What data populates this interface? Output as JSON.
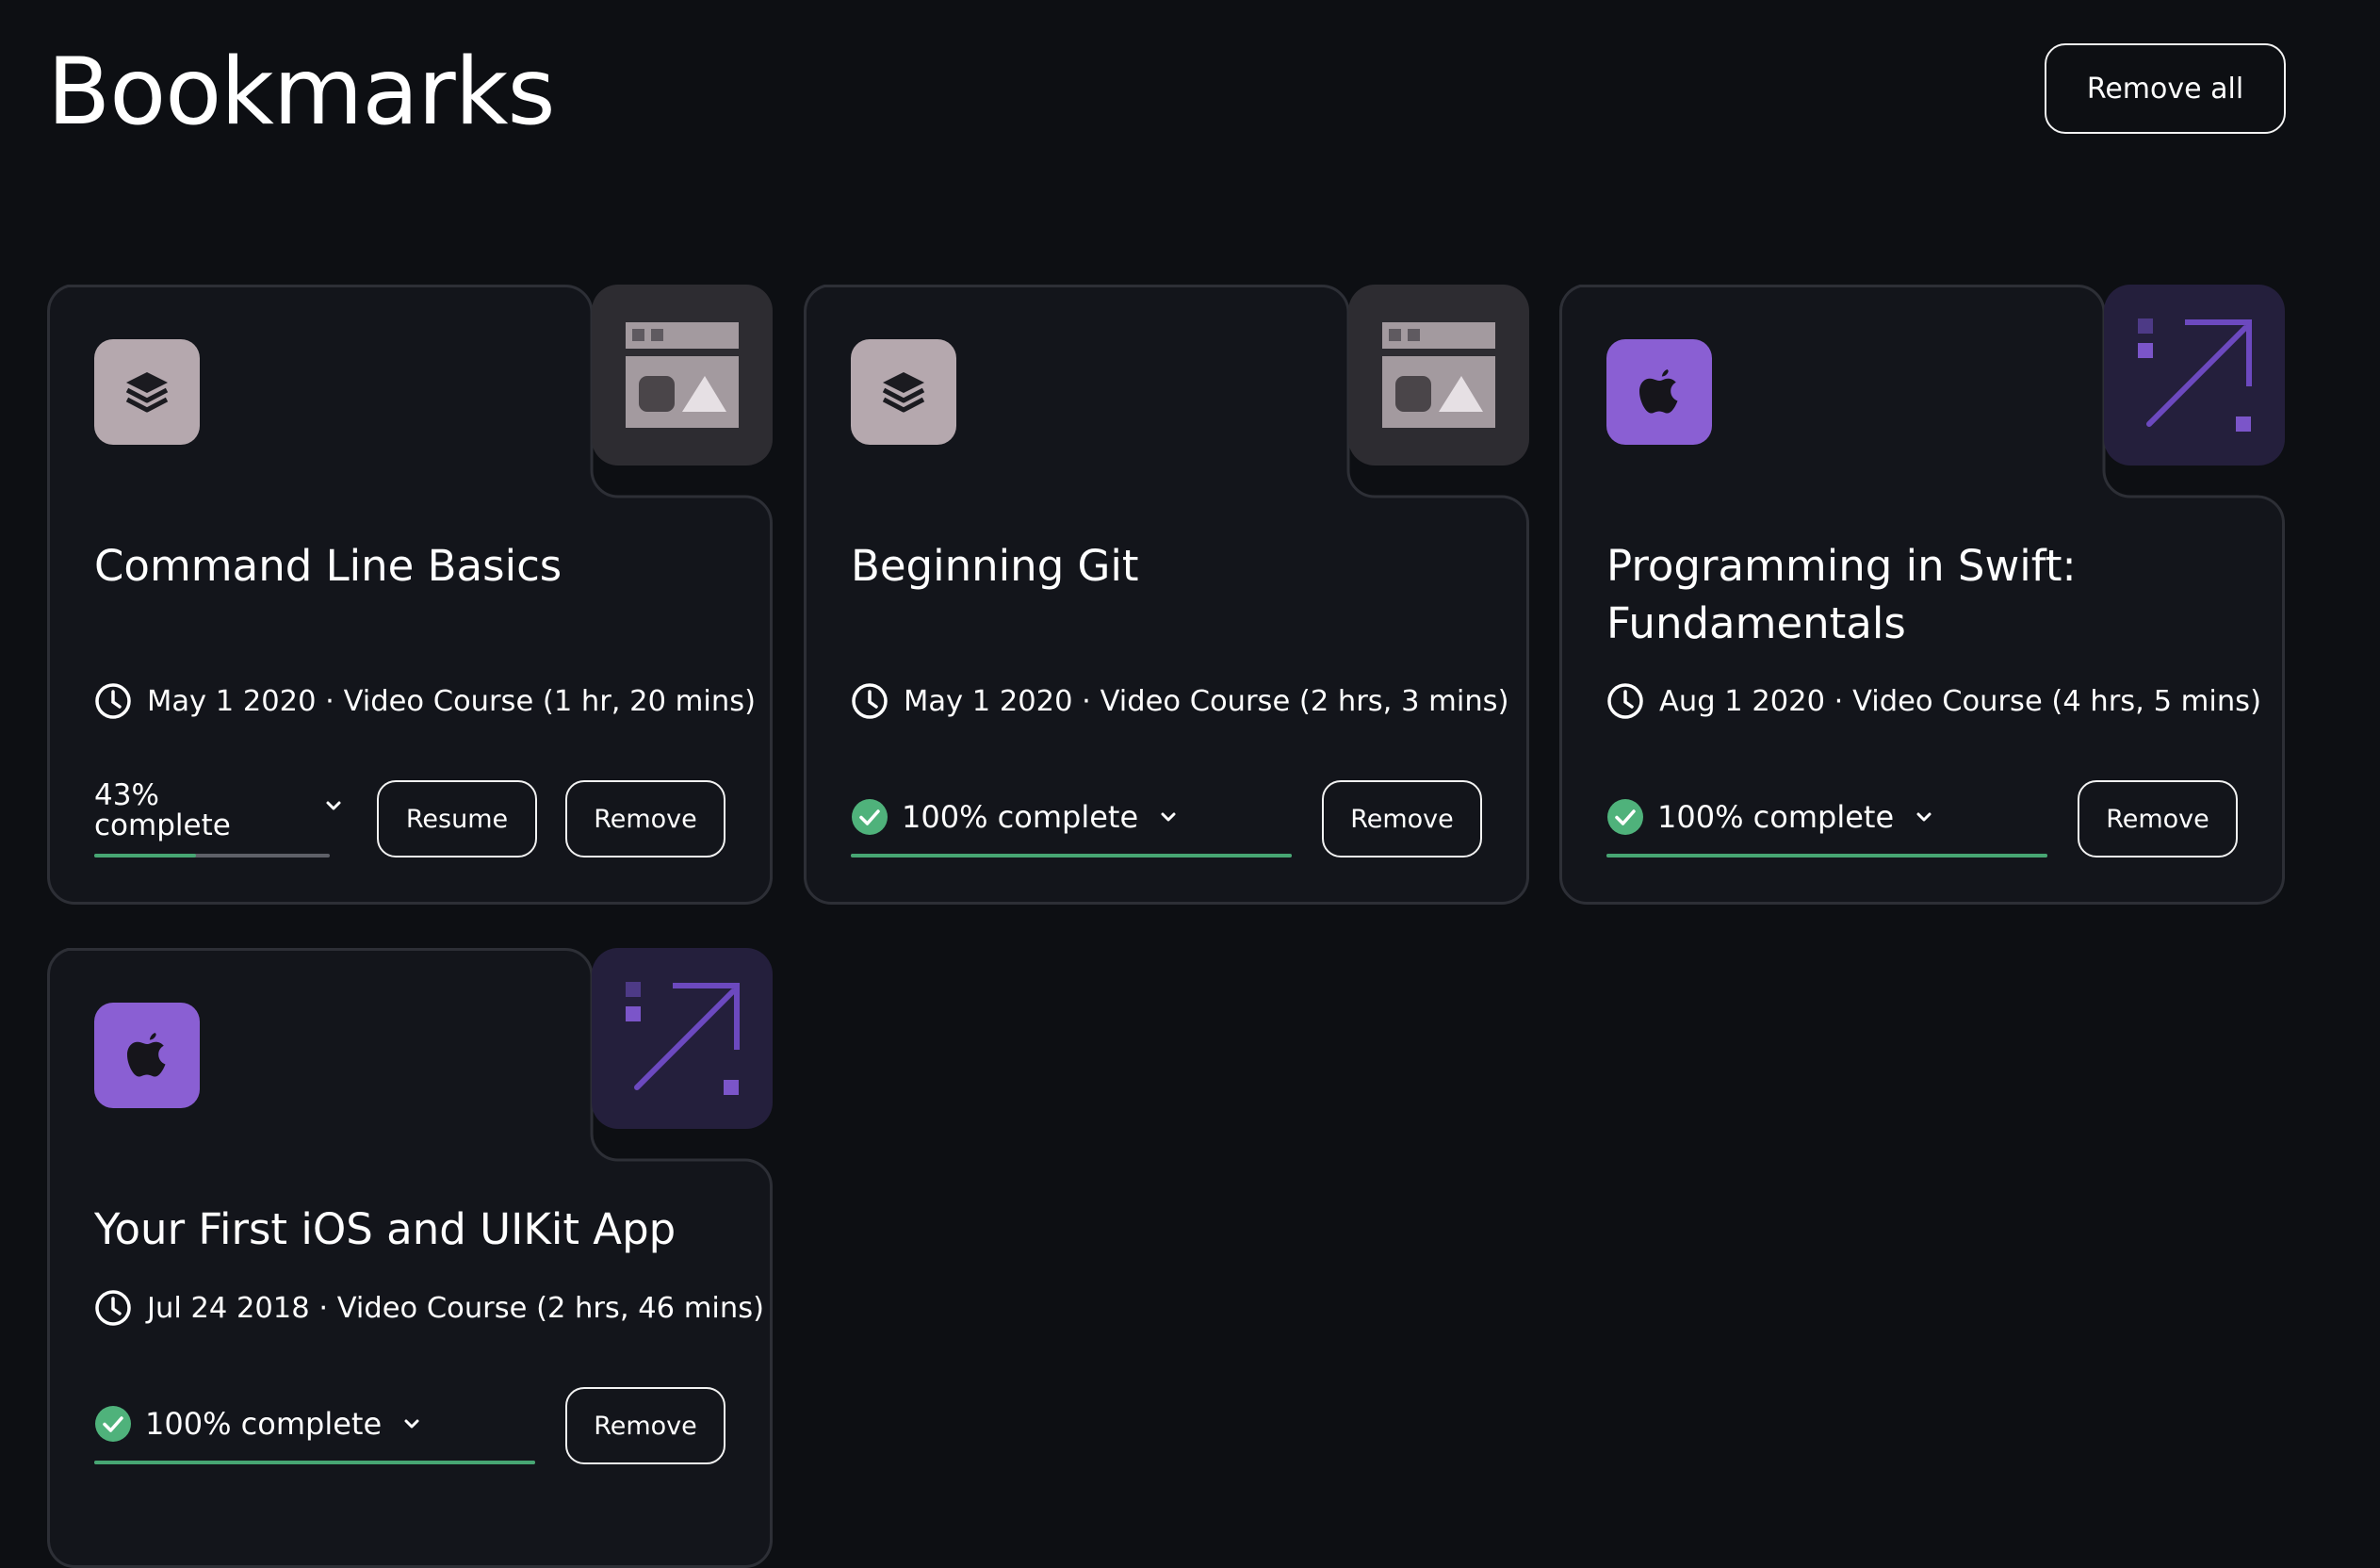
{
  "page": {
    "title": "Bookmarks",
    "remove_all_label": "Remove all"
  },
  "colors": {
    "background": "#0d0f13",
    "card_background": "#13151b",
    "card_border": "#2d2f36",
    "progress_green": "#47a673",
    "check_green": "#4fb27b",
    "purple_accent": "#8a5fd3",
    "purple_tile": "#241f3c",
    "mauve_tile": "#b5a8ae",
    "gray_tile": "#2d2c31"
  },
  "cards": [
    {
      "title": "Command Line Basics",
      "category_icon": "layers-icon",
      "thumbnail": "window-media-thumbnail",
      "date": "May 1 2020",
      "type": "Video Course",
      "duration": "(1 hr, 20 mins)",
      "progress_line1": "43%",
      "progress_line2": "complete",
      "progress_value": 43,
      "resume_label": "Resume",
      "remove_label": "Remove"
    },
    {
      "title": "Beginning Git",
      "category_icon": "layers-icon",
      "thumbnail": "window-media-thumbnail",
      "date": "May 1 2020",
      "type": "Video Course",
      "duration": "(2 hrs, 3 mins)",
      "progress_text": "100% complete",
      "progress_value": 100,
      "remove_label": "Remove"
    },
    {
      "title": "Programming in Swift: Fundamentals",
      "category_icon": "apple-icon",
      "thumbnail": "arrow-diagonal-thumbnail",
      "date": "Aug 1 2020",
      "type": "Video Course",
      "duration": "(4 hrs, 5 mins)",
      "progress_text": "100% complete",
      "progress_value": 100,
      "remove_label": "Remove"
    },
    {
      "title": "Your First iOS and UIKit App",
      "category_icon": "apple-icon",
      "thumbnail": "arrow-diagonal-thumbnail",
      "date": "Jul 24 2018",
      "type": "Video Course",
      "duration": "(2 hrs, 46 mins)",
      "progress_text": "100% complete",
      "progress_value": 100,
      "remove_label": "Remove"
    }
  ],
  "meta_separator": " · "
}
